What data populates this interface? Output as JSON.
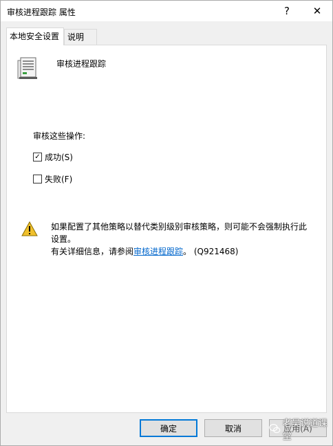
{
  "window": {
    "title": "审核进程跟踪 属性",
    "help_glyph": "?",
    "close_glyph": "✕"
  },
  "tabs": [
    {
      "label": "本地安全设置",
      "active": true
    },
    {
      "label": "说明",
      "active": false
    }
  ],
  "policy": {
    "name": "审核进程跟踪",
    "icon": "server-icon"
  },
  "audit": {
    "label": "审核这些操作:",
    "options": [
      {
        "label": "成功(S)",
        "checked": true
      },
      {
        "label": "失败(F)",
        "checked": false
      }
    ]
  },
  "warning": {
    "icon": "warning-icon",
    "line1": "如果配置了其他策略以替代类别级别审核策略，则可能不会强制执行此设置。",
    "more_prefix": "有关详细信息，请参阅",
    "link_text": "审核进程跟踪",
    "more_suffix": "。 (Q921468)"
  },
  "buttons": {
    "ok": "确定",
    "cancel": "取消",
    "apply": "应用(A)"
  },
  "watermark": {
    "text": "老吴说道课堂"
  },
  "colors": {
    "ok_border": "#0078d7",
    "link": "#0066cc",
    "warning": "#f0c02c"
  }
}
